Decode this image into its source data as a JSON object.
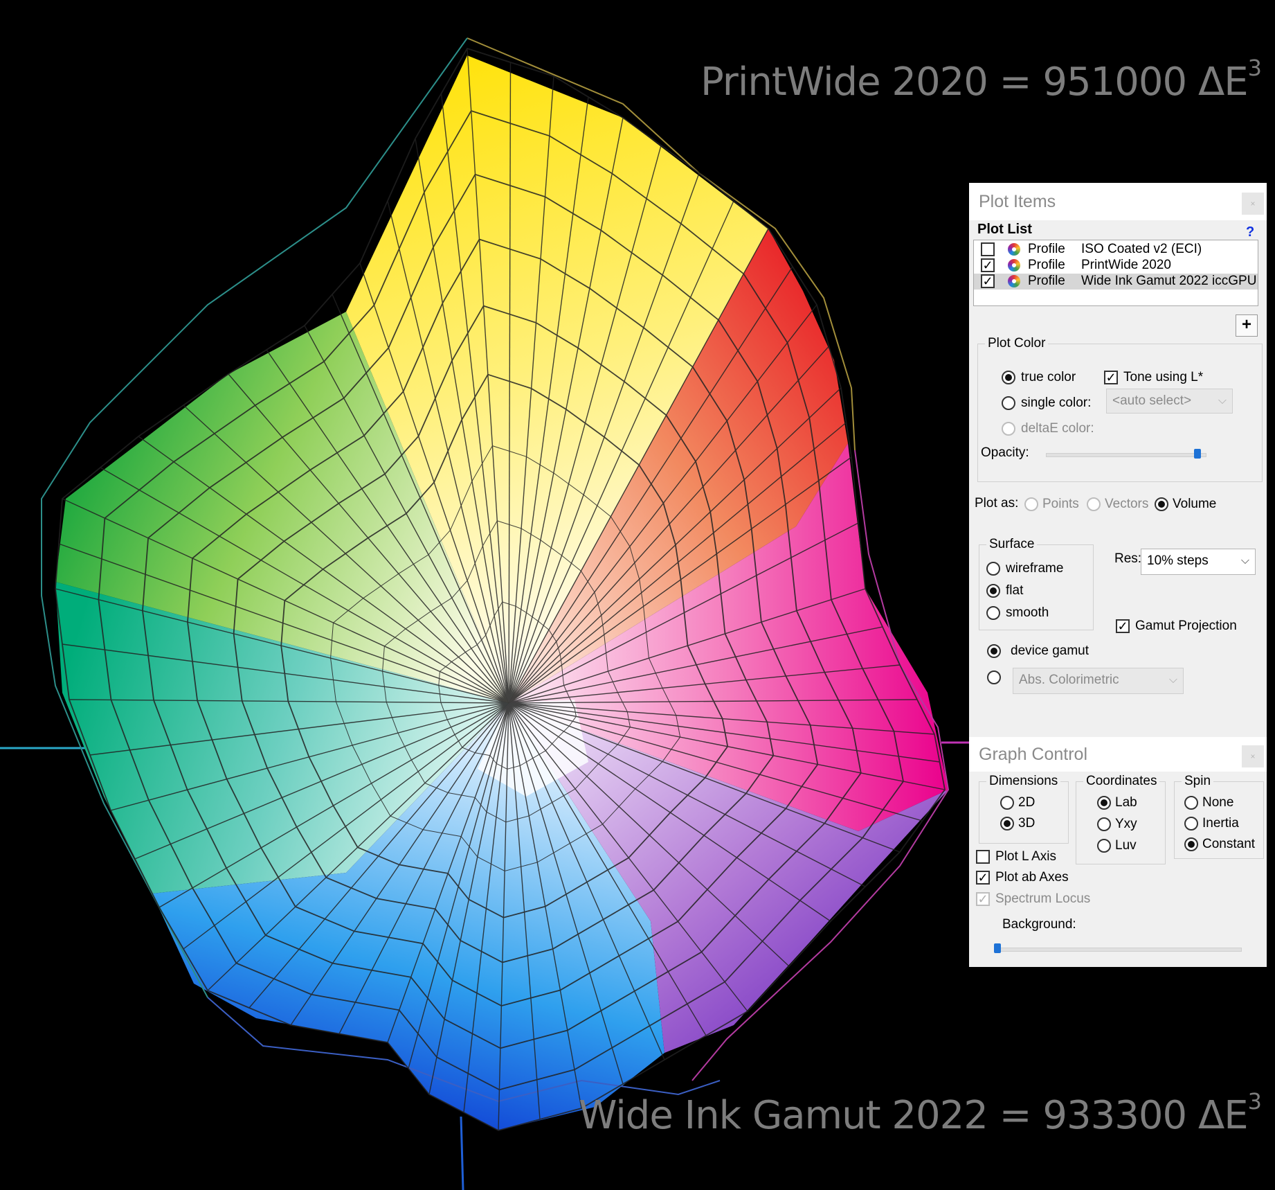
{
  "labels": {
    "printwide": "PrintWide 2020 = 951000 ΔE",
    "printwide_exp": "3",
    "wideink": "Wide Ink Gamut 2022 = 933300 ΔE",
    "wideink_exp": "3"
  },
  "plot_items": {
    "title": "Plot Items",
    "close": "×",
    "list_header": "Plot List",
    "help": "?",
    "rows": [
      {
        "checked": false,
        "type": "Profile",
        "name": "ISO Coated v2 (ECI)",
        "selected": false
      },
      {
        "checked": true,
        "type": "Profile",
        "name": "PrintWide 2020",
        "selected": false
      },
      {
        "checked": true,
        "type": "Profile",
        "name": "Wide Ink Gamut 2022 iccGPU",
        "selected": true
      }
    ],
    "add_button": "+",
    "plot_color": {
      "group": "Plot Color",
      "true_color": "true color",
      "single_color": "single color:",
      "deltae_color": "deltaE color:",
      "tone_using": "Tone using L*",
      "auto_select": "<auto select>",
      "opacity": "Opacity:",
      "opacity_value": 0.95,
      "selected": "true color",
      "tone_checked": true
    },
    "plot_as": {
      "label": "Plot as:",
      "points": "Points",
      "vectors": "Vectors",
      "volume": "Volume",
      "selected": "Volume"
    },
    "surface": {
      "group": "Surface",
      "wireframe": "wireframe",
      "flat": "flat",
      "smooth": "smooth",
      "selected": "flat"
    },
    "res_label": "Res:",
    "res_value": "10% steps",
    "gamut_projection": "Gamut Projection",
    "gamut_projection_checked": true,
    "device_gamut": "device gamut",
    "abs_colorimetric": "Abs. Colorimetric",
    "gamut_mode": "device gamut"
  },
  "graph_control": {
    "title": "Graph Control",
    "close": "×",
    "dimensions": {
      "group": "Dimensions",
      "d2": "2D",
      "d3": "3D",
      "selected": "3D"
    },
    "coordinates": {
      "group": "Coordinates",
      "lab": "Lab",
      "yxy": "Yxy",
      "luv": "Luv",
      "selected": "Lab"
    },
    "spin": {
      "group": "Spin",
      "none": "None",
      "inertia": "Inertia",
      "constant": "Constant",
      "selected": "Constant"
    },
    "plot_l_axis": "Plot L Axis",
    "plot_l_axis_checked": false,
    "plot_ab_axes": "Plot ab Axes",
    "plot_ab_axes_checked": true,
    "spectrum_locus": "Spectrum Locus",
    "spectrum_locus_checked": true,
    "background": "Background:",
    "background_value": 0.0
  },
  "colors": {
    "background": "#000000",
    "label_gray": "#7d7d7d",
    "axis_cyan": "#2aa7c7",
    "axis_magenta": "#c033b5",
    "axis_blue": "#1f5fd6",
    "wire": "#1a1a1a",
    "slider_accent": "#1e72d6"
  }
}
